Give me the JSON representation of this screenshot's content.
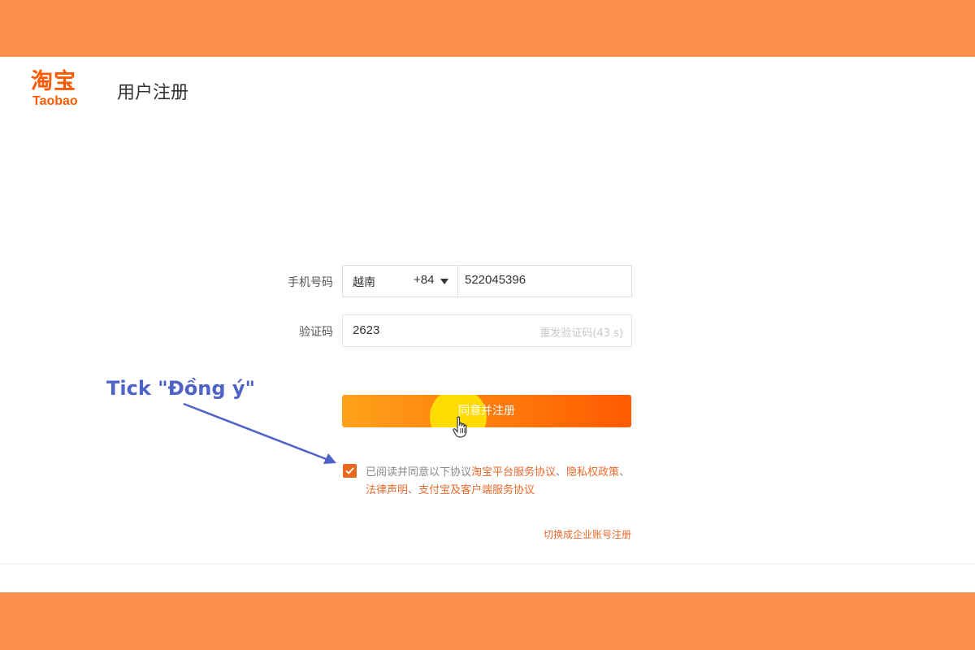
{
  "header": {
    "logo_cn": "淘宝",
    "logo_en": "Taobao",
    "title": "用户注册"
  },
  "form": {
    "phone_label": "手机号码",
    "country_name": "越南",
    "country_code": "+84",
    "phone_value": "522045396",
    "code_label": "验证码",
    "code_value": "2623",
    "resend_label": "重发验证码(43 s)",
    "submit_label": "同意并注册"
  },
  "agreement": {
    "checked": true,
    "prefix": "已阅读并同意以下协议",
    "links": [
      "淘宝平台服务协议",
      "隐私权政策",
      "法律声明",
      "支付宝及客户端服务协议"
    ],
    "separator": "、"
  },
  "footer": {
    "switch_label": "切换成企业账号注册"
  },
  "annotation": {
    "text": "Tick \"Đồng ý\"",
    "color": "#4f63c7"
  },
  "colors": {
    "band": "#ff8f4c",
    "brand": "#ff5a00",
    "link": "#ea6a2b"
  }
}
